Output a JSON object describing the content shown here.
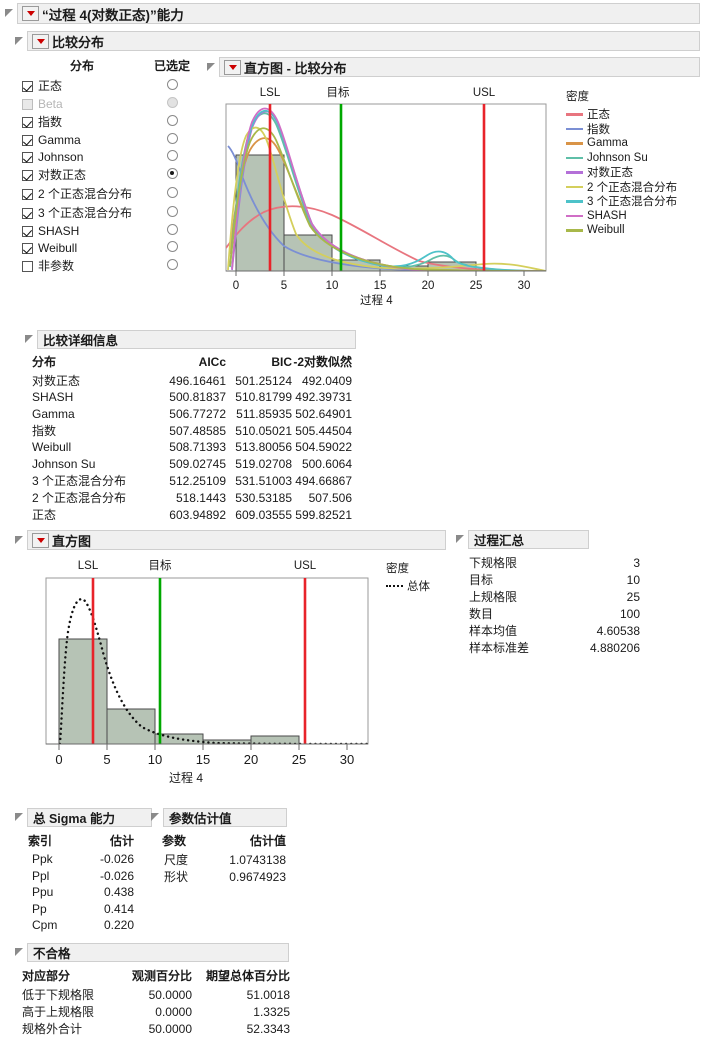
{
  "window": {
    "title": "“过程 4(对数正态)”能力"
  },
  "compare_distributions": {
    "header": "比较分布",
    "col_dist": "分布",
    "col_selected": "已选定",
    "items": [
      {
        "label": "正态",
        "checked": true,
        "enabled": true,
        "selected": false
      },
      {
        "label": "Beta",
        "checked": false,
        "enabled": false,
        "selected": false
      },
      {
        "label": "指数",
        "checked": true,
        "enabled": true,
        "selected": false
      },
      {
        "label": "Gamma",
        "checked": true,
        "enabled": true,
        "selected": false
      },
      {
        "label": "Johnson",
        "checked": true,
        "enabled": true,
        "selected": false
      },
      {
        "label": "对数正态",
        "checked": true,
        "enabled": true,
        "selected": true
      },
      {
        "label": "2 个正态混合分布",
        "checked": true,
        "enabled": true,
        "selected": false
      },
      {
        "label": "3 个正态混合分布",
        "checked": true,
        "enabled": true,
        "selected": false
      },
      {
        "label": "SHASH",
        "checked": true,
        "enabled": true,
        "selected": false
      },
      {
        "label": "Weibull",
        "checked": true,
        "enabled": true,
        "selected": false
      },
      {
        "label": "非参数",
        "checked": false,
        "enabled": true,
        "selected": false
      }
    ]
  },
  "histogram_compare": {
    "header": "直方图 - 比较分布",
    "legend_title": "密度"
  },
  "compare_details": {
    "header": "比较详细信息",
    "columns": [
      "分布",
      "AICc",
      "BIC",
      "-2对数似然"
    ],
    "rows": [
      [
        "对数正态",
        "496.16461",
        "501.25124",
        "492.0409"
      ],
      [
        "SHASH",
        "500.81837",
        "510.81799",
        "492.39731"
      ],
      [
        "Gamma",
        "506.77272",
        "511.85935",
        "502.64901"
      ],
      [
        "指数",
        "507.48585",
        "510.05021",
        "505.44504"
      ],
      [
        "Weibull",
        "508.71393",
        "513.80056",
        "504.59022"
      ],
      [
        "Johnson Su",
        "509.02745",
        "519.02708",
        "500.6064"
      ],
      [
        "3 个正态混合分布",
        "512.25109",
        "531.51003",
        "494.66867"
      ],
      [
        "2 个正态混合分布",
        "518.1443",
        "530.53185",
        "507.506"
      ],
      [
        "正态",
        "603.94892",
        "609.03555",
        "599.82521"
      ]
    ]
  },
  "histogram": {
    "header": "直方图",
    "legend_title": "密度",
    "legend_entry": "总体"
  },
  "process_summary": {
    "header": "过程汇总",
    "rows": [
      [
        "下规格限",
        "3"
      ],
      [
        "目标",
        "10"
      ],
      [
        "上规格限",
        "25"
      ],
      [
        "数目",
        "100"
      ],
      [
        "样本均值",
        "4.60538"
      ],
      [
        "样本标准差",
        "4.880206"
      ]
    ]
  },
  "overall_sigma": {
    "header": "总 Sigma 能力",
    "columns": [
      "索引",
      "估计"
    ],
    "rows": [
      [
        "Ppk",
        "-0.026"
      ],
      [
        "Ppl",
        "-0.026"
      ],
      [
        "Ppu",
        "0.438"
      ],
      [
        "Pp",
        "0.414"
      ],
      [
        "Cpm",
        "0.220"
      ]
    ]
  },
  "parameter_estimates": {
    "header": "参数估计值",
    "columns": [
      "参数",
      "估计值"
    ],
    "rows": [
      [
        "尺度",
        "1.0743138"
      ],
      [
        "形状",
        "0.9674923"
      ]
    ]
  },
  "nonconformance": {
    "header": "不合格",
    "columns": [
      "对应部分",
      "观测百分比",
      "期望总体百分比"
    ],
    "rows": [
      [
        "低于下规格限",
        "50.0000",
        "51.0018"
      ],
      [
        "高于上规格限",
        "0.0000",
        "1.3325"
      ],
      [
        "规格外合计",
        "50.0000",
        "52.3343"
      ]
    ]
  },
  "chart_data": {
    "type": "histogram",
    "title": "直方图 - 比较分布",
    "xlabel": "过程 4",
    "ylabel": "密度",
    "xlim": [
      -2,
      32
    ],
    "xticks": [
      0,
      5,
      10,
      15,
      20,
      25,
      30
    ],
    "bin_edges": [
      0,
      5,
      10,
      15,
      20,
      25
    ],
    "bin_counts": [
      70,
      19,
      6,
      2,
      3
    ],
    "bin_fill": "#b6c3b5",
    "spec_limits": {
      "LSL": {
        "label": "LSL",
        "value": 3,
        "color": "#e8232a"
      },
      "Target": {
        "label": "目标",
        "value": 10,
        "color": "#00a800"
      },
      "USL": {
        "label": "USL",
        "value": 25,
        "color": "#e8232a"
      }
    },
    "density_curves": [
      {
        "name": "正态",
        "color": "#e8757f"
      },
      {
        "name": "指数",
        "color": "#7b8fd4"
      },
      {
        "name": "Gamma",
        "color": "#d99447"
      },
      {
        "name": "Johnson Su",
        "color": "#5fbfa8"
      },
      {
        "name": "对数正态",
        "color": "#b470d8"
      },
      {
        "name": "2 个正态混合分布",
        "color": "#d4cf5c"
      },
      {
        "name": "3 个正态混合分布",
        "color": "#4dc2c9"
      },
      {
        "name": "SHASH",
        "color": "#d06ec6"
      },
      {
        "name": "Weibull",
        "color": "#a8b84a"
      }
    ],
    "fit_overlay": {
      "name": "总体",
      "style": "dotted",
      "color": "#111111"
    }
  }
}
